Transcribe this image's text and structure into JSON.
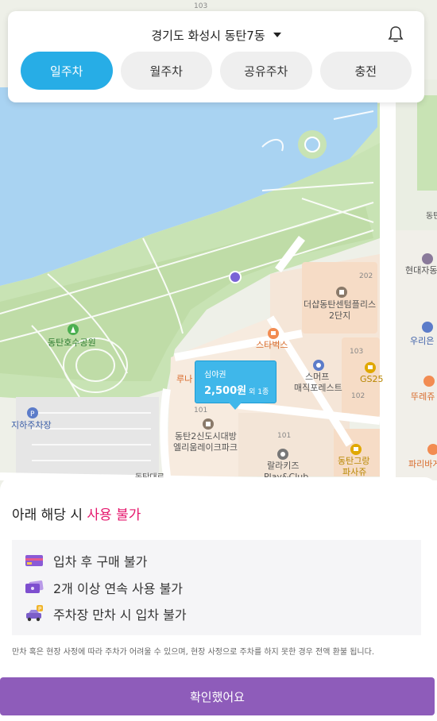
{
  "header": {
    "location": "경기도 화성시 동탄7동",
    "tabs": [
      {
        "label": "일주차",
        "active": true
      },
      {
        "label": "월주차",
        "active": false
      },
      {
        "label": "공유주차",
        "active": false
      },
      {
        "label": "충전",
        "active": false
      }
    ]
  },
  "map": {
    "labels": {
      "park": "동탄호수공원",
      "starbucks": "스타벅스",
      "complex": "더샵동탄센텀플리스",
      "complex2": "2단지",
      "apt": "동탄2신도시대방",
      "apt2": "엘리움레이크파크",
      "smuff": "스머프",
      "smuff2": "매직포레스트",
      "gs25": "GS25",
      "kids": "랄라키즈",
      "kids2": "Play&Club",
      "grand": "동탄그랑",
      "grand2": "파사쥬",
      "underground": "지하주차장",
      "hyundai": "현대자동",
      "woori": "우리은",
      "ttu": "뚜레쥬",
      "paris": "파리바게",
      "luna": "루나",
      "b202": "202",
      "b103": "103",
      "b102": "102",
      "b101": "101",
      "b101b": "101",
      "b103top": "103",
      "dongtan": "동탄",
      "road": "동탄대로"
    }
  },
  "price_bubble": {
    "label": "심야권",
    "price": "2,500원",
    "extra": "외 1종"
  },
  "sheet": {
    "title_prefix": "아래 해당 시 ",
    "title_warn": "사용 불가",
    "rules": [
      {
        "icon": "card-icon",
        "text": "입차 후 구매 불가"
      },
      {
        "icon": "tickets-icon",
        "text": "2개 이상 연속 사용 불가"
      },
      {
        "icon": "car-parking-icon",
        "text": "주차장 만차 시 입차 불가"
      }
    ],
    "note": "만차 혹은 현장 사정에 따라 주차가 어려울 수 있으며, 현장 사정으로 주차를 하지 못한 경우 전액 환불 됩니다.",
    "confirm_label": "확인했어요"
  },
  "colors": {
    "accent": "#27ade6",
    "warn": "#e5166c",
    "confirm": "#8e5cba",
    "water": "#a9d3f2",
    "park": "#cce6b9"
  }
}
